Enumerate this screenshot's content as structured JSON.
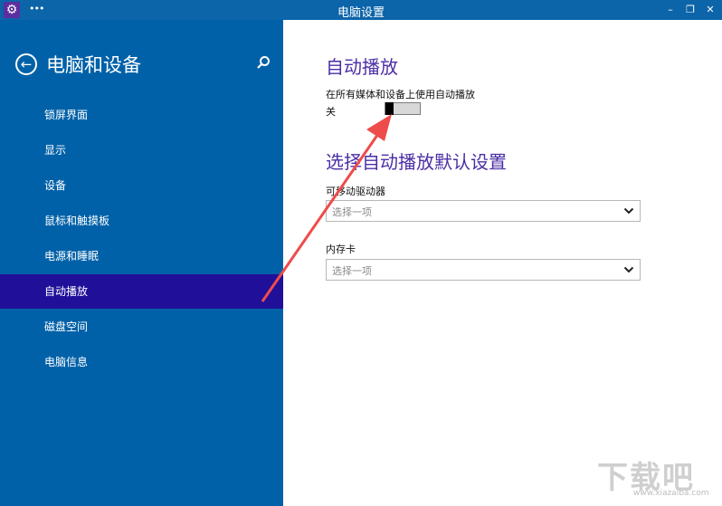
{
  "window": {
    "title": "电脑设置",
    "controls": {
      "minimize": "–",
      "restore": "❐",
      "close": "✕"
    }
  },
  "sidebar": {
    "heading": "电脑和设备",
    "items": [
      {
        "label": "锁屏界面",
        "selected": false
      },
      {
        "label": "显示",
        "selected": false
      },
      {
        "label": "设备",
        "selected": false
      },
      {
        "label": "鼠标和触摸板",
        "selected": false
      },
      {
        "label": "电源和睡眠",
        "selected": false
      },
      {
        "label": "自动播放",
        "selected": true
      },
      {
        "label": "磁盘空间",
        "selected": false
      },
      {
        "label": "电脑信息",
        "selected": false
      }
    ]
  },
  "main": {
    "autoplay_title": "自动播放",
    "autoplay_setting_label": "在所有媒体和设备上使用自动播放",
    "toggle_state_label": "关",
    "defaults_title": "选择自动播放默认设置",
    "removable_drive_label": "可移动驱动器",
    "removable_drive_value": "选择一项",
    "memory_card_label": "内存卡",
    "memory_card_value": "选择一项"
  },
  "watermark": {
    "text": "下载吧",
    "url": "www.xiazaiba.com"
  },
  "colors": {
    "titlebar": "#0c64a9",
    "sidebar": "#0061a8",
    "sidebar_selected": "#1f0f99",
    "accent_text": "#4b2ea6",
    "annotation_arrow": "#ee4b4b"
  }
}
